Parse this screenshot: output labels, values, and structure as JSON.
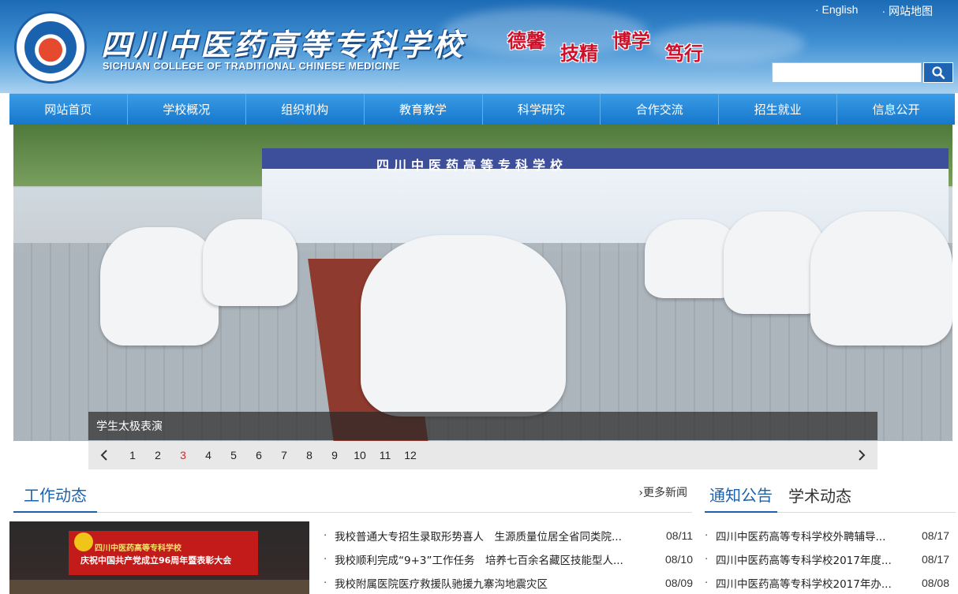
{
  "header": {
    "school_name_cn": "四川中医药高等专科学校",
    "school_name_en": "SICHUAN COLLEGE OF TRADITIONAL CHINESE MEDICINE",
    "motto": [
      "德馨",
      "技精",
      "博学",
      "笃行"
    ],
    "top_links": [
      "English",
      "网站地图"
    ],
    "search_placeholder": ""
  },
  "nav": [
    "网站首页",
    "学校概况",
    "组织机构",
    "教育教学",
    "科学研究",
    "合作交流",
    "招生就业",
    "信息公开"
  ],
  "banner": {
    "booth_title": "四川中医药高等专科学校",
    "caption": "学生太极表演",
    "pages": [
      "1",
      "2",
      "3",
      "4",
      "5",
      "6",
      "7",
      "8",
      "9",
      "10",
      "11",
      "12"
    ],
    "active_page": "3"
  },
  "work_news": {
    "title": "工作动态",
    "more": "更多新闻",
    "image_title1": "四川中医药高等专科学校",
    "image_title2": "庆祝中国共产党成立96周年暨表彰大会",
    "items": [
      {
        "title": "我校普通大专招生录取形势喜人　生源质量位居全省同类院...",
        "date": "08/11"
      },
      {
        "title": "我校顺利完成“9+3”工作任务　培养七百余名藏区技能型人...",
        "date": "08/10"
      },
      {
        "title": "我校附属医院医疗救援队驰援九寨沟地震灾区",
        "date": "08/09"
      }
    ]
  },
  "notice": {
    "tabs": [
      "通知公告",
      "学术动态"
    ],
    "items": [
      {
        "title": "四川中医药高等专科学校外聘辅导...",
        "date": "08/17"
      },
      {
        "title": "四川中医药高等专科学校2017年度...",
        "date": "08/17"
      },
      {
        "title": "四川中医药高等专科学校2017年办...",
        "date": "08/08"
      }
    ]
  }
}
